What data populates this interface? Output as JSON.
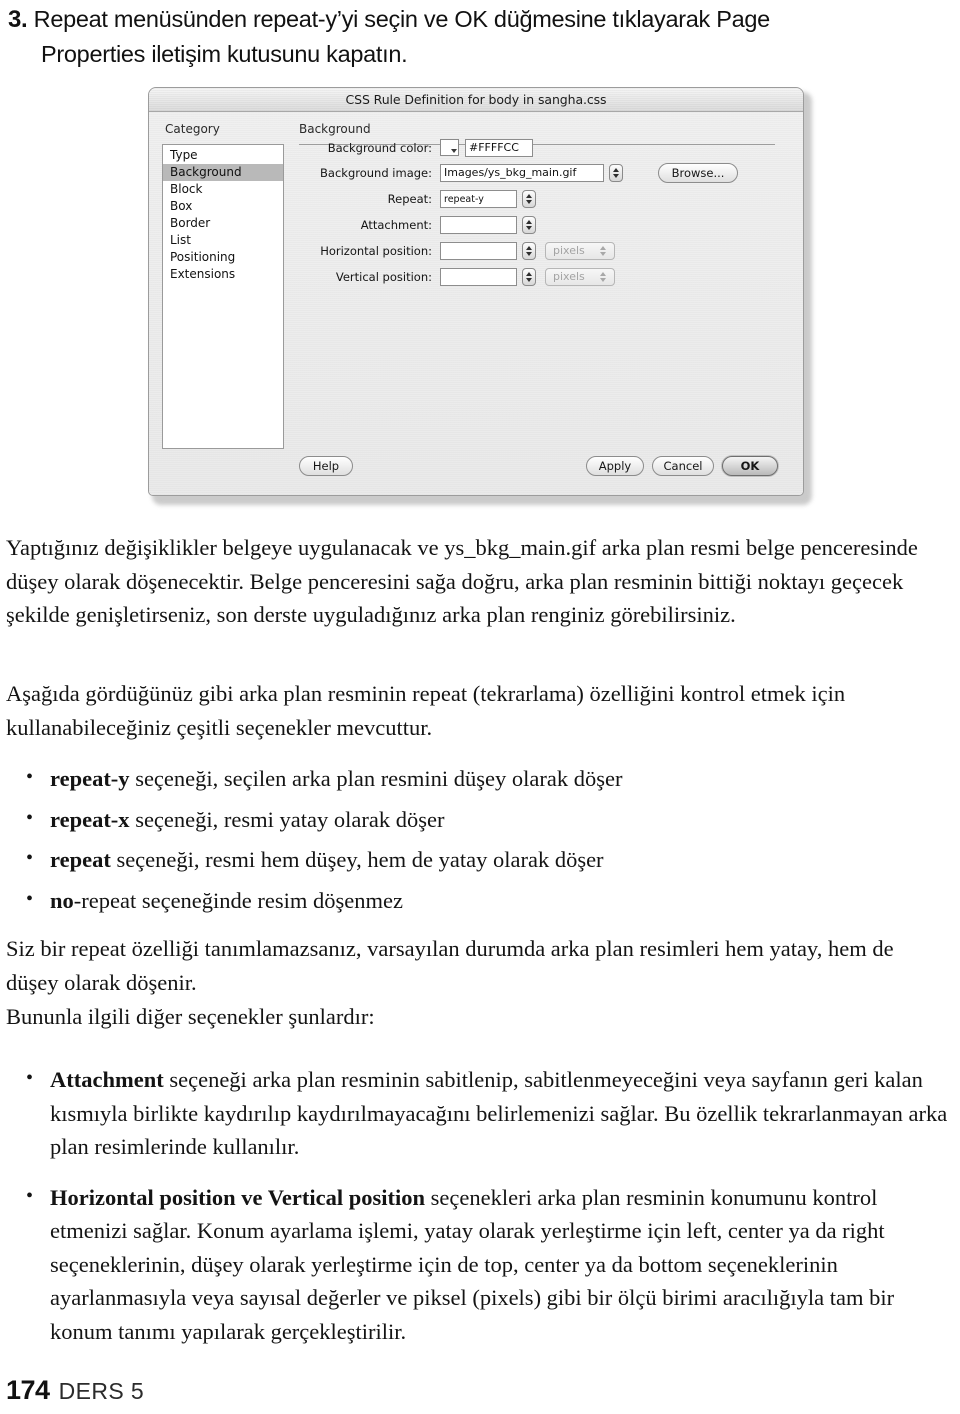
{
  "step": {
    "number": "3.",
    "line1": "Repeat menüsünden repeat-y’yi seçin ve OK düğmesine tıklayarak Page",
    "line2": "Properties iletişim kutusunu kapatın."
  },
  "dialog": {
    "title": "CSS Rule Definition for body in sangha.css",
    "category_label": "Category",
    "categories": [
      {
        "label": "Type",
        "selected": false
      },
      {
        "label": "Background",
        "selected": true
      },
      {
        "label": "Block",
        "selected": false
      },
      {
        "label": "Box",
        "selected": false
      },
      {
        "label": "Border",
        "selected": false
      },
      {
        "label": "List",
        "selected": false
      },
      {
        "label": "Positioning",
        "selected": false
      },
      {
        "label": "Extensions",
        "selected": false
      }
    ],
    "pane_title": "Background",
    "fields": {
      "background_color": {
        "label": "Background color:",
        "value": "#FFFFCC",
        "swatch_color": "#FFFFFF"
      },
      "background_image": {
        "label": "Background image:",
        "value": "Images/ys_bkg_main.gif"
      },
      "repeat": {
        "label": "Repeat:",
        "value": "repeat-y"
      },
      "attachment": {
        "label": "Attachment:",
        "value": ""
      },
      "horizontal_position": {
        "label": "Horizontal position:",
        "value": "",
        "unit": "pixels"
      },
      "vertical_position": {
        "label": "Vertical position:",
        "value": "",
        "unit": "pixels"
      }
    },
    "buttons": {
      "browse": "Browse...",
      "help": "Help",
      "apply": "Apply",
      "cancel": "Cancel",
      "ok": "OK"
    }
  },
  "prose": {
    "p1": "Yaptığınız değişiklikler belgeye uygulanacak ve ys_bkg_main.gif arka plan resmi belge penceresinde düşey olarak döşenecektir. Belge penceresini sağa doğru, arka plan resminin bittiği noktayı geçecek şekilde genişletirseniz, son derste uyguladığınız arka plan renginiz görebilirsiniz.",
    "p2": "Aşağıda gördüğünüz gibi arka plan resminin repeat (tekrarlama) özelliğini kontrol etmek için kullanabileceğiniz çeşitli seçenekler mevcuttur.",
    "p3": "Siz bir repeat özelliği tanımlamazsanız, varsayılan durumda arka plan resimleri hem yatay, hem de düşey olarak döşenir.",
    "p4": "Bununla ilgili diğer seçenekler şunlardır:"
  },
  "bullets_repeat": [
    {
      "bold": "repeat-y",
      "rest": " seçeneği, seçilen arka plan resmini düşey olarak döşer"
    },
    {
      "bold": "repeat-x",
      "rest": " seçeneği, resmi yatay olarak döşer"
    },
    {
      "bold": "repeat",
      "rest": " seçeneği, resmi hem düşey, hem de yatay olarak döşer"
    },
    {
      "bold": "no",
      "rest": "-repeat seçeneğinde resim döşenmez"
    }
  ],
  "bullets_options": [
    {
      "bold": "Attachment",
      "rest": " seçeneği arka plan resminin sabitlenip, sabitlenmeyeceğini veya sayfanın geri kalan kısmıyla birlikte kaydırılıp kaydırılmayacağını belirlemenizi sağlar. Bu özellik tekrarlanmayan arka plan resimlerinde kullanılır."
    },
    {
      "bold": "Horizontal position ve Vertical position",
      "rest": " seçenekleri arka plan resminin konumunu kontrol etmenizi sağlar. Konum ayarlama işlemi, yatay olarak yerleştirme için left, center ya da right seçeneklerinin, düşey olarak yerleştirme için de top, center ya da bottom seçeneklerinin ayarlanmasıyla veya sayısal değerler ve piksel (pixels) gibi bir ölçü birimi aracılığıyla tam bir konum tanımı yapılarak gerçekleştirilir."
    }
  ],
  "footer": {
    "page_number": "174",
    "chapter": "DERS 5"
  }
}
